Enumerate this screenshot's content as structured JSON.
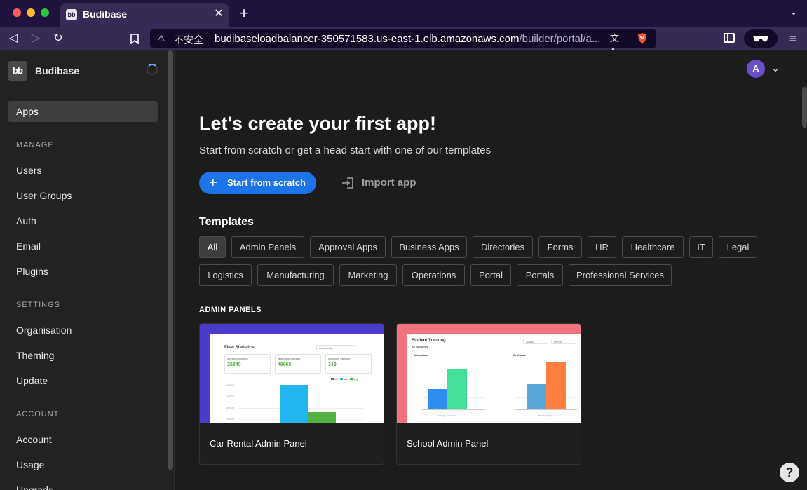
{
  "browser": {
    "tab_title": "Budibase",
    "tab_favicon_text": "bb",
    "address": {
      "security_label": "不安全",
      "url_host": "budibaseloadbalancer-350571583.us-east-1.elb.amazonaws.com",
      "url_path": "/builder/portal/a..."
    },
    "icons": {
      "back": "back-arrow-icon",
      "forward": "forward-arrow-icon",
      "reload": "reload-icon",
      "bookmark": "bookmark-icon",
      "warning": "warning-icon",
      "translate": "translate-icon",
      "brave": "brave-shield-icon",
      "sidebar": "sidebar-toggle-icon",
      "wallet": "wallet-icon",
      "menu": "menu-icon"
    }
  },
  "sidebar": {
    "brand_logo_text": "bb",
    "brand_name": "Budibase",
    "top_item": "Apps",
    "sections": [
      {
        "title": "MANAGE",
        "items": [
          "Users",
          "User Groups",
          "Auth",
          "Email",
          "Plugins"
        ]
      },
      {
        "title": "SETTINGS",
        "items": [
          "Organisation",
          "Theming",
          "Update"
        ]
      },
      {
        "title": "ACCOUNT",
        "items": [
          "Account",
          "Usage",
          "Upgrade"
        ]
      }
    ]
  },
  "header": {
    "avatar_initial": "A"
  },
  "main": {
    "title": "Let's create your first app!",
    "subtitle": "Start from scratch or get a head start with one of our templates",
    "start_button": "Start from scratch",
    "import_button": "Import app",
    "templates_heading": "Templates",
    "categories": [
      "All",
      "Admin Panels",
      "Approval Apps",
      "Business Apps",
      "Directories",
      "Forms",
      "HR",
      "Healthcare",
      "IT",
      "Legal",
      "Logistics",
      "Manufacturing",
      "Marketing",
      "Operations",
      "Portal",
      "Portals",
      "Professional Services"
    ],
    "active_category": "All",
    "section_label": "ADMIN PANELS",
    "templates": [
      {
        "name": "Car Rental Admin Panel",
        "accent": "#4b3bc9",
        "preview": {
          "title": "Fleet Statistics",
          "dropdown": "Availability",
          "stats": [
            {
              "label": "Average Mileage",
              "value": "25840"
            },
            {
              "label": "Maximum Mileage",
              "value": "49965"
            },
            {
              "label": "Minimum Mileage",
              "value": "349"
            }
          ],
          "legend": [
            "Min",
            "Max",
            "Avg"
          ],
          "y_ticks": [
            "40000",
            "30000",
            "20000",
            "10000"
          ]
        }
      },
      {
        "name": "School Admin Panel",
        "accent": "#f2727d",
        "preview": {
          "title": "Student Tracking",
          "subtitle": "All Students",
          "dropdowns": [
            "Grade",
            "Month"
          ],
          "panels": [
            {
              "label": "Attendance",
              "footer": "Average Attendance"
            },
            {
              "label": "Tardiness",
              "footer": "Tardiness Days"
            }
          ]
        }
      }
    ],
    "help": "?"
  },
  "colors": {
    "primary": "#1d73e8",
    "sidebar_bg": "#222222",
    "main_bg": "#1c1c1c",
    "chrome_bg": "#20123f",
    "toolbar_bg": "#372a57"
  }
}
